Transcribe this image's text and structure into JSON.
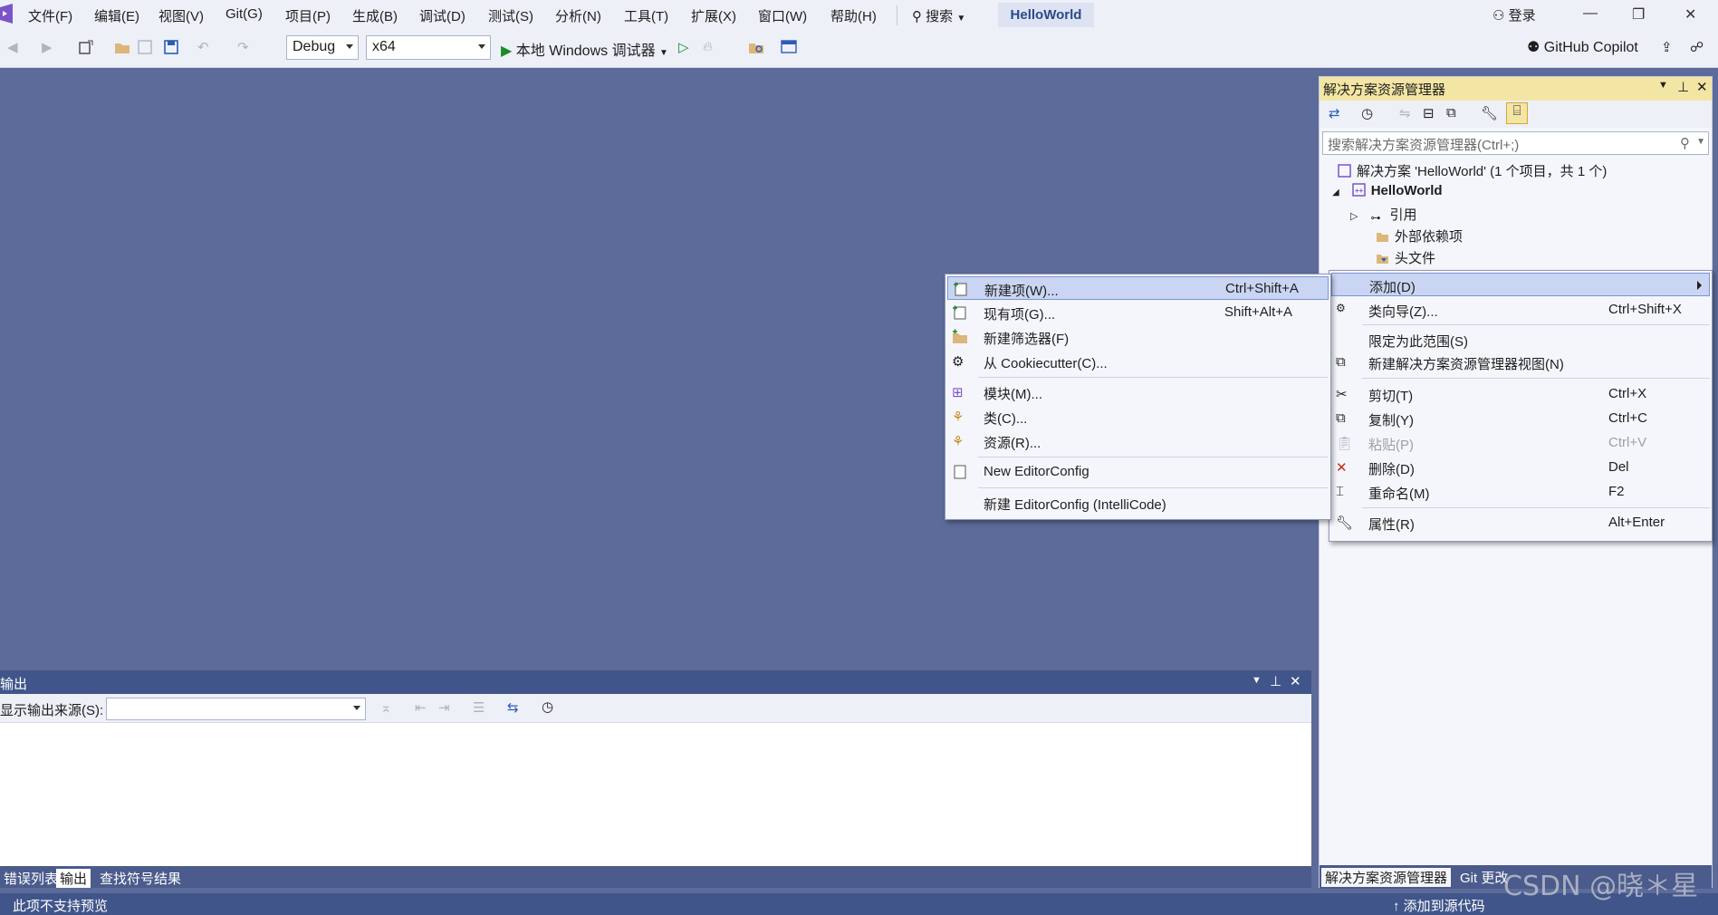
{
  "menubar": {
    "items": [
      "文件(F)",
      "编辑(E)",
      "视图(V)",
      "Git(G)",
      "项目(P)",
      "生成(B)",
      "调试(D)",
      "测试(S)",
      "分析(N)",
      "工具(T)",
      "扩展(X)",
      "窗口(W)",
      "帮助(H)"
    ],
    "search_label": "搜索",
    "solution_name": "HelloWorld",
    "login": "登录"
  },
  "toolbar": {
    "config": "Debug",
    "platform": "x64",
    "run_label": "本地 Windows 调试器",
    "copilot": "GitHub Copilot"
  },
  "solution_explorer": {
    "title": "解决方案资源管理器",
    "search_placeholder": "搜索解决方案资源管理器(Ctrl+;)",
    "tree": [
      {
        "label": "解决方案 'HelloWorld' (1 个项目，共 1 个)",
        "icon": "solution-icon"
      },
      {
        "label": "HelloWorld",
        "icon": "project-icon"
      },
      {
        "label": "引用",
        "icon": "references-icon"
      },
      {
        "label": "外部依赖项",
        "icon": "external-deps-icon"
      },
      {
        "label": "头文件",
        "icon": "header-filter-icon"
      }
    ],
    "tabs": [
      "解决方案资源管理器",
      "Git 更改"
    ]
  },
  "context_menu": {
    "items": [
      {
        "label": "添加(D)",
        "shortcut": "",
        "icon": ""
      },
      {
        "label": "类向导(Z)...",
        "shortcut": "Ctrl+Shift+X",
        "icon": "class-wizard-icon"
      },
      {
        "label": "限定为此范围(S)",
        "shortcut": "",
        "icon": ""
      },
      {
        "label": "新建解决方案资源管理器视图(N)",
        "shortcut": "",
        "icon": "new-view-icon"
      },
      {
        "label": "剪切(T)",
        "shortcut": "Ctrl+X",
        "icon": "cut-icon"
      },
      {
        "label": "复制(Y)",
        "shortcut": "Ctrl+C",
        "icon": "copy-icon"
      },
      {
        "label": "粘贴(P)",
        "shortcut": "Ctrl+V",
        "icon": "paste-icon"
      },
      {
        "label": "删除(D)",
        "shortcut": "Del",
        "icon": "delete-icon"
      },
      {
        "label": "重命名(M)",
        "shortcut": "F2",
        "icon": "rename-icon"
      },
      {
        "label": "属性(R)",
        "shortcut": "Alt+Enter",
        "icon": "properties-icon"
      }
    ]
  },
  "add_submenu": {
    "items": [
      {
        "label": "新建项(W)...",
        "shortcut": "Ctrl+Shift+A",
        "icon": "new-item-icon"
      },
      {
        "label": "现有项(G)...",
        "shortcut": "Shift+Alt+A",
        "icon": "existing-item-icon"
      },
      {
        "label": "新建筛选器(F)",
        "shortcut": "",
        "icon": "new-filter-icon"
      },
      {
        "label": "从 Cookiecutter(C)...",
        "shortcut": "",
        "icon": "cookiecutter-icon"
      },
      {
        "label": "模块(M)...",
        "shortcut": "",
        "icon": "module-icon"
      },
      {
        "label": "类(C)...",
        "shortcut": "",
        "icon": "class-icon"
      },
      {
        "label": "资源(R)...",
        "shortcut": "",
        "icon": "resource-icon"
      },
      {
        "label": "New EditorConfig",
        "shortcut": "",
        "icon": "editorconfig-icon"
      },
      {
        "label": "新建 EditorConfig (IntelliCode)",
        "shortcut": "",
        "icon": ""
      }
    ]
  },
  "output": {
    "title": "输出",
    "source_label": "显示输出来源(S):",
    "tabs": [
      "错误列表",
      "输出",
      "查找符号结果"
    ]
  },
  "status": {
    "left": "此项不支持预览",
    "right": "添加到源代码"
  },
  "watermark": "CSDN @晓＊星",
  "colors": {
    "accent": "#40558a",
    "highlight": "#c9d5f2",
    "background": "#5c6b99"
  }
}
